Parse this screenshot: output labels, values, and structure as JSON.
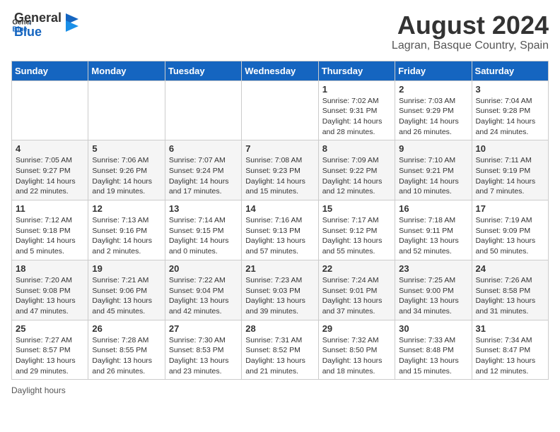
{
  "header": {
    "logo_general": "General",
    "logo_blue": "Blue",
    "month_year": "August 2024",
    "location": "Lagran, Basque Country, Spain"
  },
  "days_of_week": [
    "Sunday",
    "Monday",
    "Tuesday",
    "Wednesday",
    "Thursday",
    "Friday",
    "Saturday"
  ],
  "weeks": [
    [
      {
        "day": "",
        "detail": ""
      },
      {
        "day": "",
        "detail": ""
      },
      {
        "day": "",
        "detail": ""
      },
      {
        "day": "",
        "detail": ""
      },
      {
        "day": "1",
        "detail": "Sunrise: 7:02 AM\nSunset: 9:31 PM\nDaylight: 14 hours and 28 minutes."
      },
      {
        "day": "2",
        "detail": "Sunrise: 7:03 AM\nSunset: 9:29 PM\nDaylight: 14 hours and 26 minutes."
      },
      {
        "day": "3",
        "detail": "Sunrise: 7:04 AM\nSunset: 9:28 PM\nDaylight: 14 hours and 24 minutes."
      }
    ],
    [
      {
        "day": "4",
        "detail": "Sunrise: 7:05 AM\nSunset: 9:27 PM\nDaylight: 14 hours and 22 minutes."
      },
      {
        "day": "5",
        "detail": "Sunrise: 7:06 AM\nSunset: 9:26 PM\nDaylight: 14 hours and 19 minutes."
      },
      {
        "day": "6",
        "detail": "Sunrise: 7:07 AM\nSunset: 9:24 PM\nDaylight: 14 hours and 17 minutes."
      },
      {
        "day": "7",
        "detail": "Sunrise: 7:08 AM\nSunset: 9:23 PM\nDaylight: 14 hours and 15 minutes."
      },
      {
        "day": "8",
        "detail": "Sunrise: 7:09 AM\nSunset: 9:22 PM\nDaylight: 14 hours and 12 minutes."
      },
      {
        "day": "9",
        "detail": "Sunrise: 7:10 AM\nSunset: 9:21 PM\nDaylight: 14 hours and 10 minutes."
      },
      {
        "day": "10",
        "detail": "Sunrise: 7:11 AM\nSunset: 9:19 PM\nDaylight: 14 hours and 7 minutes."
      }
    ],
    [
      {
        "day": "11",
        "detail": "Sunrise: 7:12 AM\nSunset: 9:18 PM\nDaylight: 14 hours and 5 minutes."
      },
      {
        "day": "12",
        "detail": "Sunrise: 7:13 AM\nSunset: 9:16 PM\nDaylight: 14 hours and 2 minutes."
      },
      {
        "day": "13",
        "detail": "Sunrise: 7:14 AM\nSunset: 9:15 PM\nDaylight: 14 hours and 0 minutes."
      },
      {
        "day": "14",
        "detail": "Sunrise: 7:16 AM\nSunset: 9:13 PM\nDaylight: 13 hours and 57 minutes."
      },
      {
        "day": "15",
        "detail": "Sunrise: 7:17 AM\nSunset: 9:12 PM\nDaylight: 13 hours and 55 minutes."
      },
      {
        "day": "16",
        "detail": "Sunrise: 7:18 AM\nSunset: 9:11 PM\nDaylight: 13 hours and 52 minutes."
      },
      {
        "day": "17",
        "detail": "Sunrise: 7:19 AM\nSunset: 9:09 PM\nDaylight: 13 hours and 50 minutes."
      }
    ],
    [
      {
        "day": "18",
        "detail": "Sunrise: 7:20 AM\nSunset: 9:08 PM\nDaylight: 13 hours and 47 minutes."
      },
      {
        "day": "19",
        "detail": "Sunrise: 7:21 AM\nSunset: 9:06 PM\nDaylight: 13 hours and 45 minutes."
      },
      {
        "day": "20",
        "detail": "Sunrise: 7:22 AM\nSunset: 9:04 PM\nDaylight: 13 hours and 42 minutes."
      },
      {
        "day": "21",
        "detail": "Sunrise: 7:23 AM\nSunset: 9:03 PM\nDaylight: 13 hours and 39 minutes."
      },
      {
        "day": "22",
        "detail": "Sunrise: 7:24 AM\nSunset: 9:01 PM\nDaylight: 13 hours and 37 minutes."
      },
      {
        "day": "23",
        "detail": "Sunrise: 7:25 AM\nSunset: 9:00 PM\nDaylight: 13 hours and 34 minutes."
      },
      {
        "day": "24",
        "detail": "Sunrise: 7:26 AM\nSunset: 8:58 PM\nDaylight: 13 hours and 31 minutes."
      }
    ],
    [
      {
        "day": "25",
        "detail": "Sunrise: 7:27 AM\nSunset: 8:57 PM\nDaylight: 13 hours and 29 minutes."
      },
      {
        "day": "26",
        "detail": "Sunrise: 7:28 AM\nSunset: 8:55 PM\nDaylight: 13 hours and 26 minutes."
      },
      {
        "day": "27",
        "detail": "Sunrise: 7:30 AM\nSunset: 8:53 PM\nDaylight: 13 hours and 23 minutes."
      },
      {
        "day": "28",
        "detail": "Sunrise: 7:31 AM\nSunset: 8:52 PM\nDaylight: 13 hours and 21 minutes."
      },
      {
        "day": "29",
        "detail": "Sunrise: 7:32 AM\nSunset: 8:50 PM\nDaylight: 13 hours and 18 minutes."
      },
      {
        "day": "30",
        "detail": "Sunrise: 7:33 AM\nSunset: 8:48 PM\nDaylight: 13 hours and 15 minutes."
      },
      {
        "day": "31",
        "detail": "Sunrise: 7:34 AM\nSunset: 8:47 PM\nDaylight: 13 hours and 12 minutes."
      }
    ]
  ],
  "footer": {
    "note": "Daylight hours"
  }
}
